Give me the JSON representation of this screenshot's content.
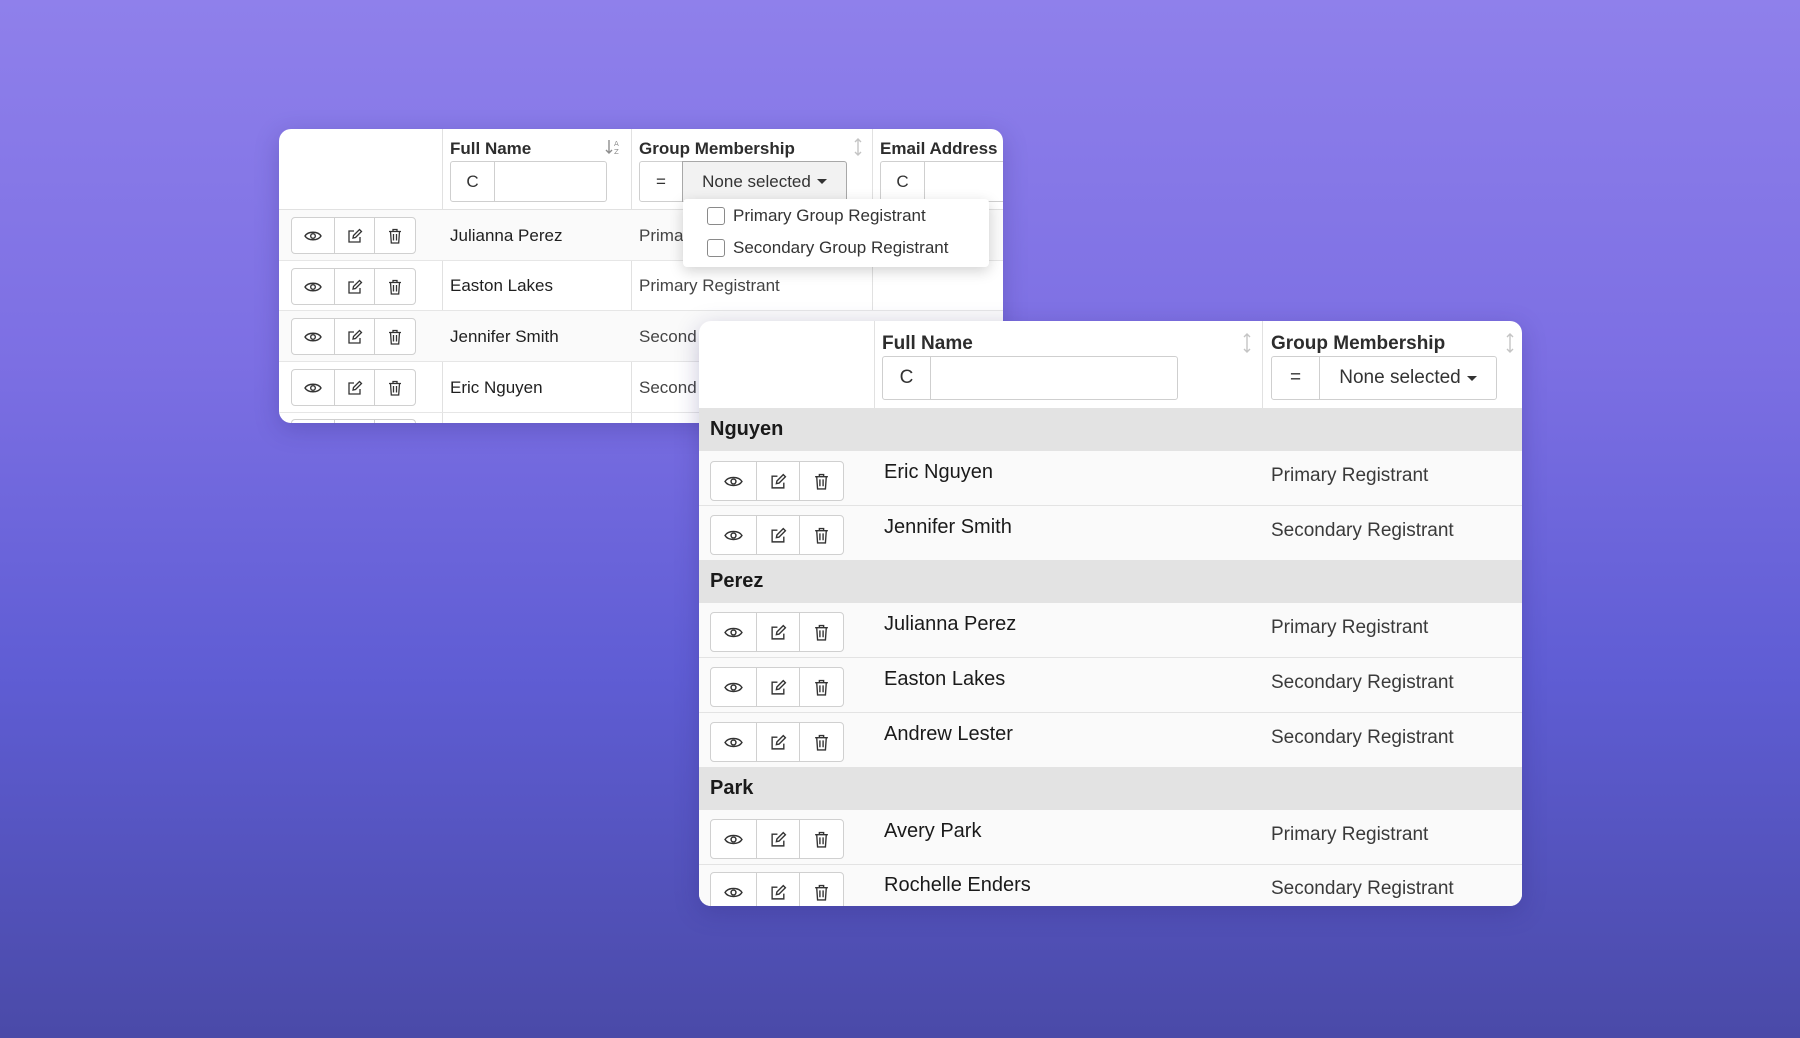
{
  "back_table": {
    "columns": {
      "full_name": "Full Name",
      "group_membership": "Group Membership",
      "email_address": "Email Address"
    },
    "filters": {
      "name_mode": "C",
      "name_value": "",
      "group_mode": "=",
      "group_value": "None selected",
      "email_mode": "C",
      "email_value": ""
    },
    "dropdown_options": [
      "Primary Group Registrant",
      "Secondary Group Registrant"
    ],
    "rows": [
      {
        "name": "Julianna Perez",
        "group": "Prima"
      },
      {
        "name": "Easton Lakes",
        "group": "Primary Registrant"
      },
      {
        "name": "Jennifer Smith",
        "group": "Second"
      },
      {
        "name": "Eric Nguyen",
        "group": "Second"
      }
    ]
  },
  "front_table": {
    "columns": {
      "full_name": "Full Name",
      "group_membership": "Group Membership"
    },
    "filters": {
      "name_mode": "C",
      "name_value": "",
      "group_mode": "=",
      "group_value": "None selected"
    },
    "groups": [
      {
        "label": "Nguyen",
        "rows": [
          {
            "name": "Eric Nguyen",
            "group": "Primary Registrant"
          },
          {
            "name": "Jennifer Smith",
            "group": "Secondary Registrant"
          }
        ]
      },
      {
        "label": "Perez",
        "rows": [
          {
            "name": "Julianna Perez",
            "group": "Primary Registrant"
          },
          {
            "name": "Easton Lakes",
            "group": "Secondary Registrant"
          },
          {
            "name": "Andrew Lester",
            "group": "Secondary Registrant"
          }
        ]
      },
      {
        "label": "Park",
        "rows": [
          {
            "name": "Avery Park",
            "group": "Primary Registrant"
          },
          {
            "name": "Rochelle Enders",
            "group": "Secondary Registrant"
          }
        ]
      }
    ]
  },
  "icons": {
    "view": "eye-icon",
    "edit": "edit-icon",
    "delete": "trash-icon",
    "sort_asc": "sort-alpha-icon",
    "sort_neutral": "sort-updown-icon"
  },
  "colors": {
    "background_top": "#8f80eb",
    "background_bottom": "#4a4aa8",
    "group_header_bg": "#e3e3e3"
  }
}
